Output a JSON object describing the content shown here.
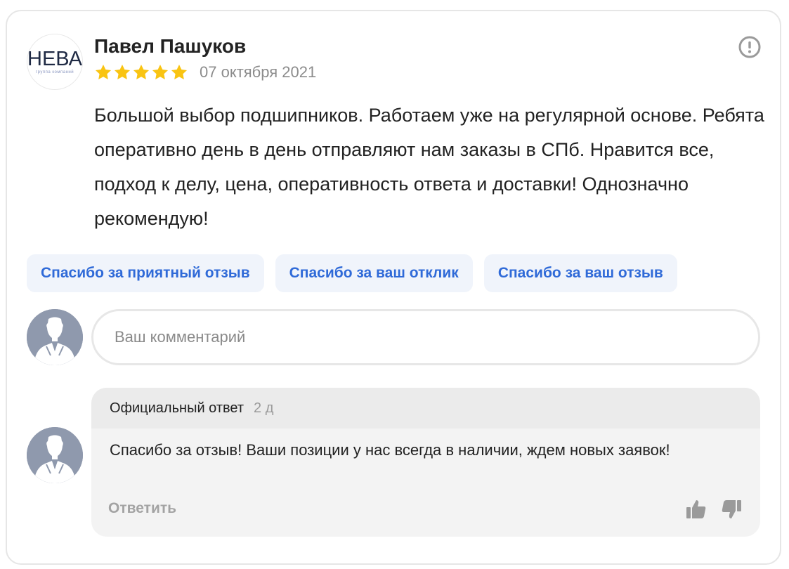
{
  "review": {
    "logo_text": "НЕВА",
    "logo_subtitle": "группа компаний",
    "author": "Павел Пашуков",
    "rating": 5,
    "rating_max": 5,
    "date": "07 октября 2021",
    "text": "Большой выбор подшипников. Работаем уже на регулярной основе. Ребята оперативно день в день отправляют нам заказы в СПб. Нравится все, подход к делу, цена, оперативность ответа и доставки! Однозначно рекомендую!"
  },
  "quick_replies": [
    "Спасибо за приятный отзыв",
    "Спасибо за ваш отклик",
    "Спасибо за ваш отзыв"
  ],
  "comment": {
    "placeholder": "Ваш комментарий",
    "value": ""
  },
  "official_reply": {
    "label": "Официальный ответ",
    "age": "2 д",
    "text": "Спасибо за отзыв! Ваши позиции у нас всегда в наличии, ждем новых заявок!",
    "reply_label": "Ответить"
  },
  "icons": {
    "report": "exclamation-circle-icon",
    "like": "thumbs-up-icon",
    "dislike": "thumbs-down-icon",
    "avatar": "user-silhouette-icon",
    "star": "star-icon"
  },
  "colors": {
    "star": "#f9c412",
    "link": "#2f6ad8",
    "quick_reply_bg": "#f0f4fb",
    "avatar_bg": "#8f99ad",
    "icon_gray": "#9a9a9a"
  }
}
